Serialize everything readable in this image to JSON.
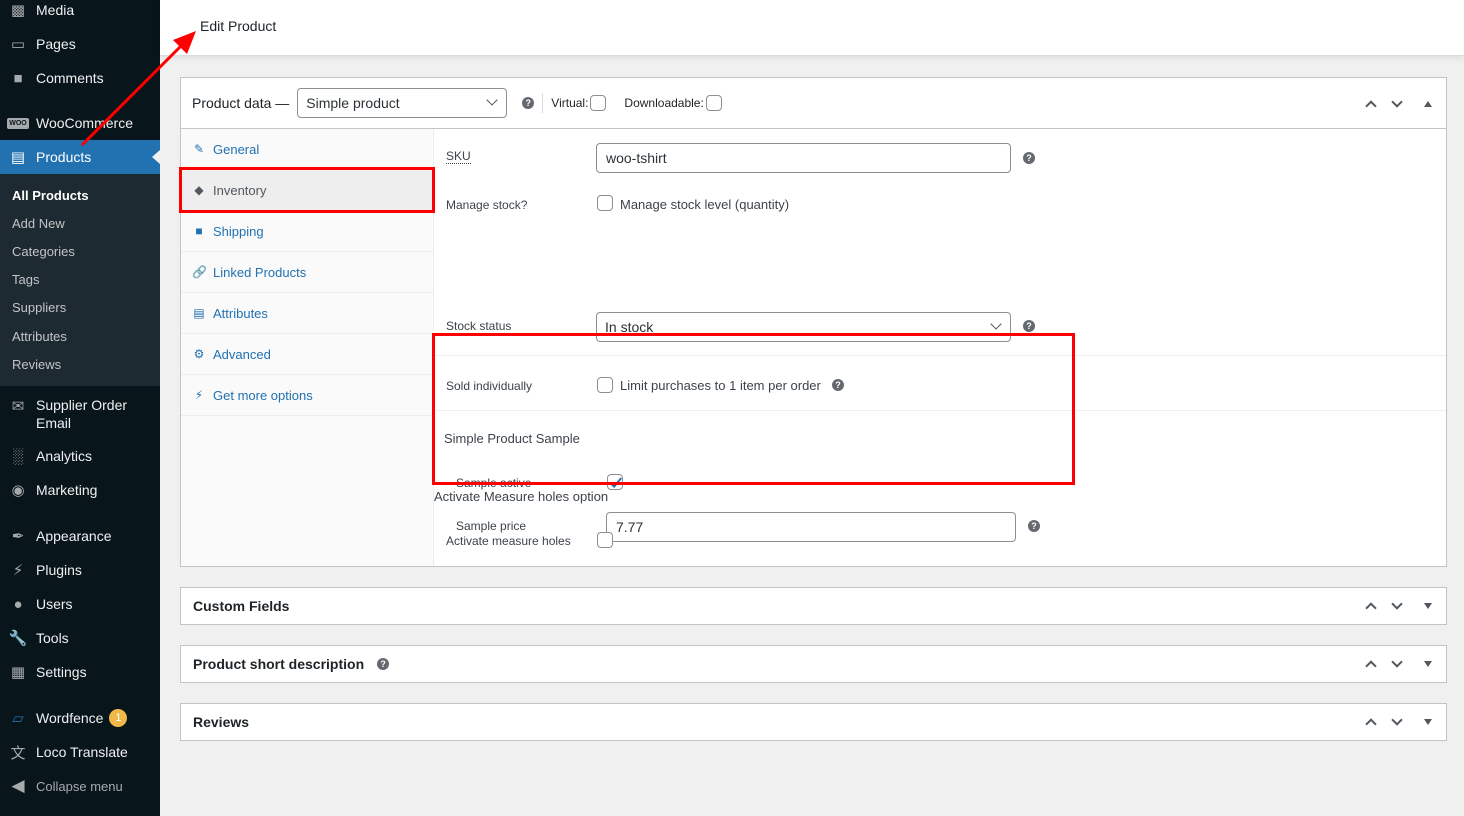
{
  "sidebar": {
    "items": [
      {
        "label": "Media",
        "icon": "media-icon"
      },
      {
        "label": "Pages",
        "icon": "pages-icon"
      },
      {
        "label": "Comments",
        "icon": "comments-icon"
      },
      {
        "label": "WooCommerce",
        "icon": "woocommerce-icon"
      },
      {
        "label": "Products",
        "icon": "products-icon",
        "current": true
      },
      {
        "label": "Supplier Order Email",
        "icon": "envelope-icon"
      },
      {
        "label": "Analytics",
        "icon": "analytics-icon"
      },
      {
        "label": "Marketing",
        "icon": "megaphone-icon"
      },
      {
        "label": "Appearance",
        "icon": "paintbrush-icon"
      },
      {
        "label": "Plugins",
        "icon": "plug-icon"
      },
      {
        "label": "Users",
        "icon": "users-icon"
      },
      {
        "label": "Tools",
        "icon": "wrench-icon"
      },
      {
        "label": "Settings",
        "icon": "settings-icon"
      },
      {
        "label": "Wordfence",
        "icon": "wordfence-icon",
        "badge": "1"
      },
      {
        "label": "Loco Translate",
        "icon": "translate-icon"
      }
    ],
    "submenu": [
      "All Products",
      "Add New",
      "Categories",
      "Tags",
      "Suppliers",
      "Attributes",
      "Reviews"
    ],
    "collapse_label": "Collapse menu"
  },
  "header": {
    "title": "Edit Product"
  },
  "product_data": {
    "label": "Product data —",
    "type_select": "Simple product",
    "virtual_label": "Virtual:",
    "virtual_checked": false,
    "downloadable_label": "Downloadable:",
    "downloadable_checked": false,
    "tabs": [
      {
        "label": "General",
        "icon": "wrench-icon"
      },
      {
        "label": "Inventory",
        "icon": "tag-icon",
        "active": true
      },
      {
        "label": "Shipping",
        "icon": "truck-icon"
      },
      {
        "label": "Linked Products",
        "icon": "link-icon"
      },
      {
        "label": "Attributes",
        "icon": "list-icon"
      },
      {
        "label": "Advanced",
        "icon": "gear-icon"
      },
      {
        "label": "Get more options",
        "icon": "plug-icon"
      }
    ],
    "inventory": {
      "sku_label": "SKU",
      "sku_value": "woo-tshirt",
      "manage_stock_label": "Manage stock?",
      "manage_stock_text": "Manage stock level (quantity)",
      "manage_stock_checked": false,
      "stock_status_label": "Stock status",
      "stock_status_value": "In stock",
      "sold_individually_label": "Sold individually",
      "sold_individually_text": "Limit purchases to 1 item per order",
      "sold_individually_checked": false
    },
    "sample": {
      "title": "Simple Product Sample",
      "active_label": "Sample active",
      "active_checked": true,
      "price_label": "Sample price",
      "price_value": "7.77"
    },
    "measure": {
      "title": "Activate Measure holes option",
      "label": "Activate measure holes",
      "checked": false
    }
  },
  "boxes": [
    {
      "title": "Custom Fields",
      "help": false
    },
    {
      "title": "Product short description",
      "help": true
    },
    {
      "title": "Reviews",
      "help": false
    }
  ],
  "colors": {
    "accent": "#2271b1",
    "sidebar": "#08151b",
    "annotation": "#ff0000"
  }
}
